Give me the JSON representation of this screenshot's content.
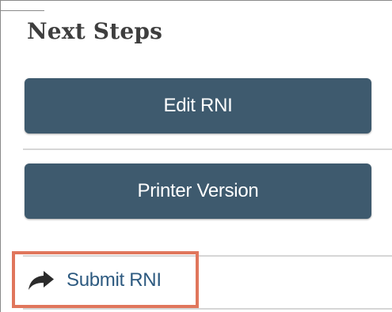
{
  "panel": {
    "title": "Next Steps"
  },
  "actions": {
    "edit_label": "Edit RNI",
    "printer_label": "Printer Version",
    "submit_label": "Submit RNI",
    "submit_icon": "share-arrow-icon"
  },
  "colors": {
    "button_background": "#3e5a6e",
    "button_text": "#ffffff",
    "link_text": "#2d5a80",
    "highlight_border": "#e0765c",
    "heading_text": "#3e3e3e"
  }
}
